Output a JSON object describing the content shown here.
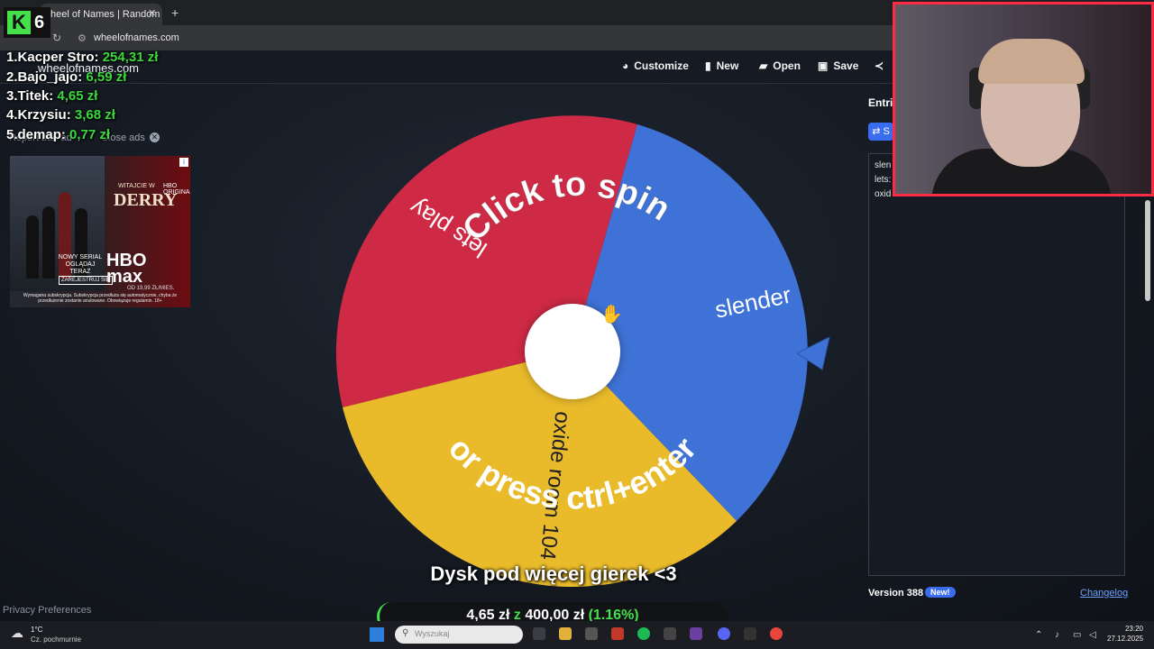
{
  "browser": {
    "tab_title": "heel of Names | Random nam",
    "tab_close": "✕",
    "new_tab": "+",
    "url": "wheelofnames.com"
  },
  "site": {
    "name": "wheelofnames.com",
    "menu": {
      "customize": "Customize",
      "new": "New",
      "open": "Open",
      "save": "Save"
    }
  },
  "logo": {
    "k": "K",
    "six": "6"
  },
  "leaderboard": [
    {
      "rank": "1.",
      "name": "Kacper Stro:",
      "amount": "254,31 zł"
    },
    {
      "rank": "2.",
      "name": "Bajo_jajo:",
      "amount": "6,59 zł"
    },
    {
      "rank": "3.",
      "name": "Titek:",
      "amount": "4,65 zł"
    },
    {
      "rank": "4.",
      "name": "Krzysiu:",
      "amount": "3,68 zł"
    },
    {
      "rank": "5.",
      "name": "demap:",
      "amount": "0,77 zł"
    }
  ],
  "ads": {
    "report": "Report bad ad",
    "close": "Close ads",
    "close_x": "✕",
    "badge": "i",
    "hbo_small": "HBO ORIGINAL",
    "title": "DERRY",
    "title_small": "WITAJCIE W",
    "tag": "NOWY SERIAL OGLĄDAJ TERAZ",
    "cta": "ZAREJESTRUJ SIĘ",
    "logo_top": "HBO",
    "logo_bottom": "max",
    "price": "OD 19,99 ZŁ/MIES.",
    "fine": "Wymagana subskrypcja. Subskrypcja przedłuża się automatycznie, chyba że przedłużenie zostanie anulowane. Obowiązuje regulamin. 18+"
  },
  "privacy": "Privacy Preferences",
  "wheel": {
    "colors": {
      "red": "#cf2a45",
      "blue": "#3f72d6",
      "yellow": "#e9bb2b"
    },
    "entries": [
      "lets play",
      "slender",
      "oxide room 104"
    ],
    "prompt_top": "Click to spin",
    "prompt_bottom": "or press ctrl+enter"
  },
  "panel": {
    "title": "Entrie",
    "shuffle": "⇄ S",
    "list": [
      "slen",
      "lets:",
      "oxid"
    ],
    "version": "Version 388",
    "new_badge": "New!",
    "changelog": "Changelog"
  },
  "stream": {
    "subtitle": "Dysk pod więcej gierek <3",
    "goal_current": "4,65 zł",
    "goal_sep": "z",
    "goal_target": "400,00 zł",
    "goal_pct": "(1.16%)"
  },
  "taskbar": {
    "temp": "1°C",
    "weather": "Cz. pochmurnie",
    "search_placeholder": "Wyszukaj",
    "time": "23:20",
    "date": "27.12.2025"
  }
}
